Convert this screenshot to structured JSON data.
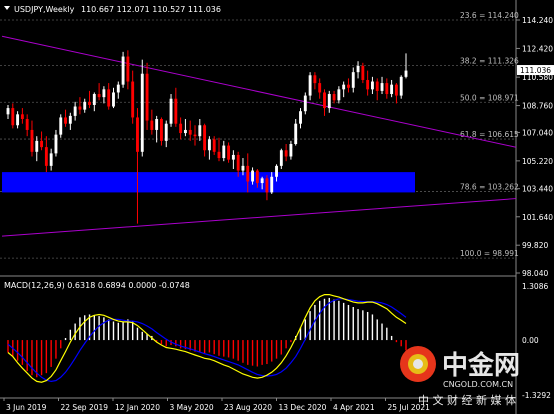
{
  "header": {
    "symbol_tf": "USDJPY,Weekly",
    "ohlc": "110.667 112.071 110.527 111.036"
  },
  "price_axis": {
    "ticks": [
      "114.240",
      "112.420",
      "110.580",
      "108.760",
      "107.040",
      "105.220",
      "103.440",
      "101.640",
      "99.820",
      "98.040"
    ],
    "current_price": "111.036",
    "current_price_color": "#ffffff"
  },
  "fib_levels": [
    {
      "label": "23.6 = 114.240",
      "price": 114.24
    },
    {
      "label": "38.2 = 111.326",
      "price": 111.326
    },
    {
      "label": "50.0 = 108.971",
      "price": 108.971
    },
    {
      "label": "61.8 = 106.615",
      "price": 106.615
    },
    {
      "label": "78.6 = 103.262",
      "price": 103.262
    },
    {
      "label": "100.0 = 98.991",
      "price": 98.991
    }
  ],
  "time_axis": [
    "3 Jun 2019",
    "22 Sep 2019",
    "12 Jan 2020",
    "3 May 2020",
    "23 Aug 2020",
    "13 Dec 2020",
    "4 Apr 2021",
    "25 Jul 2021"
  ],
  "macd": {
    "label": "MACD(12,26,9) 0.6318 0.6894 0.0000 -0.0748",
    "axis_ticks": [
      "1.3086",
      "0.00",
      "-1.3292"
    ],
    "colors": {
      "hist_pos": "#ffffff",
      "hist_neg": "#ff0000",
      "main": "#ffff00",
      "signal": "#0000ff"
    }
  },
  "watermark": {
    "brand": "中金网",
    "domain": "CNGOLD.COM.CN",
    "slogan": "中 文 财 经 新 媒 体"
  },
  "colors": {
    "bull": "#ffffff",
    "bear": "#ff0000",
    "channel": "#aa00cc",
    "zone": "#0000ff",
    "background": "#000000",
    "grid": "#555555"
  },
  "chart_data": {
    "type": "candlestick",
    "symbol": "USDJPY",
    "timeframe": "Weekly",
    "x_ticks": [
      "3 Jun 2019",
      "22 Sep 2019",
      "12 Jan 2020",
      "3 May 2020",
      "23 Aug 2020",
      "13 Dec 2020",
      "4 Apr 2021",
      "25 Jul 2021"
    ],
    "ylim": [
      98.04,
      115.5
    ],
    "candles": [
      [
        108.2,
        108.8,
        107.9,
        108.6
      ],
      [
        108.6,
        108.9,
        107.3,
        107.5
      ],
      [
        107.5,
        108.4,
        107.3,
        108.2
      ],
      [
        108.2,
        108.6,
        107.6,
        107.9
      ],
      [
        107.9,
        108.2,
        106.8,
        107.2
      ],
      [
        107.2,
        107.8,
        105.5,
        105.8
      ],
      [
        105.8,
        106.8,
        105.2,
        106.5
      ],
      [
        106.5,
        107.1,
        105.9,
        106.1
      ],
      [
        106.1,
        106.8,
        104.5,
        104.9
      ],
      [
        104.9,
        106.0,
        104.6,
        105.7
      ],
      [
        105.7,
        107.2,
        105.5,
        106.9
      ],
      [
        106.9,
        108.2,
        106.7,
        108.0
      ],
      [
        108.0,
        108.5,
        107.4,
        107.6
      ],
      [
        107.6,
        108.3,
        107.2,
        108.1
      ],
      [
        108.1,
        109.0,
        107.8,
        108.7
      ],
      [
        108.7,
        109.3,
        108.2,
        108.5
      ],
      [
        108.5,
        109.2,
        108.3,
        109.0
      ],
      [
        109.0,
        109.7,
        108.6,
        108.8
      ],
      [
        108.8,
        109.6,
        108.4,
        109.5
      ],
      [
        109.5,
        110.2,
        109.1,
        109.3
      ],
      [
        109.3,
        110.0,
        108.9,
        109.8
      ],
      [
        109.8,
        110.2,
        108.5,
        108.7
      ],
      [
        108.7,
        109.9,
        108.6,
        109.6
      ],
      [
        109.6,
        110.3,
        109.2,
        110.1
      ],
      [
        110.1,
        112.2,
        109.9,
        111.9
      ],
      [
        111.9,
        112.3,
        109.8,
        110.3
      ],
      [
        110.3,
        111.0,
        107.6,
        108.0
      ],
      [
        108.0,
        108.6,
        101.2,
        105.8
      ],
      [
        105.8,
        111.7,
        105.5,
        110.8
      ],
      [
        110.8,
        111.5,
        107.2,
        107.8
      ],
      [
        107.8,
        108.5,
        106.9,
        107.2
      ],
      [
        107.2,
        108.1,
        106.4,
        107.9
      ],
      [
        107.9,
        108.0,
        106.2,
        106.5
      ],
      [
        106.5,
        107.8,
        106.1,
        107.6
      ],
      [
        107.6,
        109.5,
        107.4,
        109.2
      ],
      [
        109.2,
        109.9,
        107.4,
        107.6
      ],
      [
        107.6,
        108.0,
        106.6,
        107.0
      ],
      [
        107.0,
        107.9,
        106.8,
        107.2
      ],
      [
        107.2,
        107.8,
        106.5,
        106.9
      ],
      [
        106.9,
        107.5,
        106.2,
        106.8
      ],
      [
        106.8,
        107.9,
        106.5,
        107.5
      ],
      [
        107.5,
        107.6,
        105.5,
        105.9
      ],
      [
        105.9,
        106.8,
        105.3,
        106.6
      ],
      [
        106.6,
        106.8,
        105.6,
        105.8
      ],
      [
        105.8,
        106.7,
        105.2,
        105.4
      ],
      [
        105.4,
        106.5,
        105.2,
        106.2
      ],
      [
        106.2,
        106.4,
        105.1,
        105.3
      ],
      [
        105.3,
        105.9,
        104.7,
        105.6
      ],
      [
        105.6,
        105.8,
        104.2,
        104.6
      ],
      [
        104.6,
        105.4,
        104.3,
        104.9
      ],
      [
        104.9,
        105.7,
        103.2,
        103.9
      ],
      [
        103.9,
        104.8,
        103.7,
        104.6
      ],
      [
        104.6,
        104.7,
        103.5,
        103.8
      ],
      [
        103.8,
        104.2,
        103.4,
        104.1
      ],
      [
        104.1,
        104.3,
        102.7,
        103.2
      ],
      [
        103.2,
        104.5,
        103.1,
        104.2
      ],
      [
        104.2,
        105.0,
        103.9,
        104.9
      ],
      [
        104.9,
        106.0,
        104.7,
        105.9
      ],
      [
        105.9,
        106.3,
        105.2,
        105.5
      ],
      [
        105.5,
        106.5,
        105.3,
        106.3
      ],
      [
        106.3,
        107.9,
        106.2,
        107.6
      ],
      [
        107.6,
        108.6,
        107.3,
        108.4
      ],
      [
        108.4,
        109.6,
        108.2,
        109.4
      ],
      [
        109.4,
        110.9,
        109.1,
        110.7
      ],
      [
        110.7,
        110.9,
        109.8,
        110.2
      ],
      [
        110.2,
        110.5,
        109.2,
        109.6
      ],
      [
        109.6,
        109.8,
        108.1,
        108.6
      ],
      [
        108.6,
        109.7,
        108.3,
        109.5
      ],
      [
        109.5,
        109.7,
        108.9,
        109.1
      ],
      [
        109.1,
        110.0,
        108.9,
        109.8
      ],
      [
        109.8,
        110.3,
        109.3,
        110.1
      ],
      [
        110.1,
        110.5,
        109.6,
        109.9
      ],
      [
        109.9,
        111.2,
        109.6,
        110.9
      ],
      [
        110.9,
        111.6,
        110.5,
        111.3
      ],
      [
        111.3,
        111.5,
        110.2,
        110.4
      ],
      [
        110.4,
        111.0,
        109.4,
        109.8
      ],
      [
        109.8,
        110.6,
        109.5,
        110.3
      ],
      [
        110.3,
        110.5,
        109.1,
        109.7
      ],
      [
        109.7,
        110.6,
        109.5,
        110.2
      ],
      [
        110.2,
        110.5,
        109.2,
        109.5
      ],
      [
        109.5,
        110.4,
        109.3,
        110.1
      ],
      [
        110.1,
        110.2,
        108.9,
        109.4
      ],
      [
        109.4,
        110.7,
        109.2,
        110.6
      ],
      [
        110.6,
        112.1,
        110.5,
        111.0
      ]
    ],
    "fibonacci": [
      {
        "level": "23.6",
        "price": 114.24
      },
      {
        "level": "38.2",
        "price": 111.326
      },
      {
        "level": "50.0",
        "price": 108.971
      },
      {
        "level": "61.8",
        "price": 106.615
      },
      {
        "level": "78.6",
        "price": 103.262
      },
      {
        "level": "100.0",
        "price": 98.991
      }
    ],
    "support_zone": [
      103.2,
      104.5
    ],
    "channel_lines": [
      {
        "from": [
          0,
          113.2
        ],
        "to": [
          98,
          106.7
        ]
      },
      {
        "from": [
          0,
          100.4
        ],
        "to": [
          98,
          102.6
        ]
      }
    ],
    "macd": {
      "params": "12,26,9",
      "ylim": [
        -1.3292,
        1.3086
      ],
      "histogram": [
        -0.3,
        -0.4,
        -0.5,
        -0.6,
        -0.75,
        -0.85,
        -0.9,
        -0.85,
        -0.8,
        -0.65,
        -0.45,
        -0.2,
        0.05,
        0.25,
        0.4,
        0.55,
        0.6,
        0.62,
        0.6,
        0.58,
        0.55,
        0.5,
        0.45,
        0.42,
        0.45,
        0.5,
        0.45,
        0.3,
        0.2,
        0.15,
        0.1,
        -0.05,
        -0.1,
        -0.15,
        -0.12,
        -0.15,
        -0.2,
        -0.22,
        -0.25,
        -0.28,
        -0.3,
        -0.32,
        -0.3,
        -0.34,
        -0.38,
        -0.4,
        -0.42,
        -0.45,
        -0.5,
        -0.55,
        -0.6,
        -0.62,
        -0.64,
        -0.6,
        -0.58,
        -0.52,
        -0.45,
        -0.35,
        -0.2,
        -0.05,
        0.1,
        0.3,
        0.5,
        0.7,
        0.85,
        0.95,
        1.0,
        1.02,
        0.98,
        0.95,
        0.9,
        0.85,
        0.8,
        0.75,
        0.72,
        0.68,
        0.62,
        0.5,
        0.4,
        0.3,
        0.1,
        -0.05,
        -0.15,
        -0.25,
        -0.4,
        -0.5,
        -0.55,
        -0.6,
        -0.58,
        -0.5,
        -0.35,
        -0.2
      ],
      "main_line": [
        -0.3,
        -0.4,
        -0.55,
        -0.68,
        -0.8,
        -0.92,
        -1.0,
        -1.02,
        -0.98,
        -0.88,
        -0.72,
        -0.5,
        -0.28,
        -0.05,
        0.15,
        0.32,
        0.45,
        0.55,
        0.6,
        0.62,
        0.6,
        0.55,
        0.5,
        0.46,
        0.44,
        0.44,
        0.42,
        0.35,
        0.25,
        0.15,
        0.05,
        -0.05,
        -0.12,
        -0.18,
        -0.2,
        -0.22,
        -0.25,
        -0.28,
        -0.32,
        -0.36,
        -0.4,
        -0.44,
        -0.46,
        -0.5,
        -0.55,
        -0.6,
        -0.64,
        -0.7,
        -0.76,
        -0.82,
        -0.86,
        -0.9,
        -0.92,
        -0.9,
        -0.85,
        -0.78,
        -0.68,
        -0.55,
        -0.38,
        -0.18,
        0.05,
        0.3,
        0.55,
        0.78,
        0.95,
        1.05,
        1.1,
        1.1,
        1.07,
        1.04,
        1.0,
        0.96,
        0.92,
        0.9,
        0.9,
        0.92,
        0.92,
        0.88,
        0.82,
        0.76,
        0.65,
        0.55,
        0.48,
        0.4,
        0.33,
        0.28,
        0.26,
        0.26,
        0.28,
        0.3,
        0.34,
        0.38
      ],
      "signal_line": [
        -0.1,
        -0.2,
        -0.3,
        -0.42,
        -0.55,
        -0.68,
        -0.8,
        -0.9,
        -0.97,
        -1.0,
        -0.98,
        -0.9,
        -0.78,
        -0.62,
        -0.44,
        -0.25,
        -0.08,
        0.08,
        0.22,
        0.34,
        0.42,
        0.48,
        0.5,
        0.5,
        0.48,
        0.46,
        0.46,
        0.44,
        0.4,
        0.34,
        0.27,
        0.18,
        0.1,
        0.02,
        -0.05,
        -0.1,
        -0.14,
        -0.18,
        -0.21,
        -0.25,
        -0.29,
        -0.33,
        -0.36,
        -0.4,
        -0.44,
        -0.48,
        -0.52,
        -0.56,
        -0.6,
        -0.66,
        -0.72,
        -0.78,
        -0.83,
        -0.86,
        -0.87,
        -0.86,
        -0.83,
        -0.77,
        -0.68,
        -0.55,
        -0.4,
        -0.2,
        0.02,
        0.25,
        0.47,
        0.65,
        0.8,
        0.9,
        0.96,
        1.0,
        1.0,
        0.98,
        0.96,
        0.94,
        0.93,
        0.93,
        0.93,
        0.92,
        0.9,
        0.86,
        0.8,
        0.72,
        0.64,
        0.55,
        0.46,
        0.38,
        0.32,
        0.28,
        0.24,
        0.2,
        0.15,
        0.1
      ]
    }
  }
}
